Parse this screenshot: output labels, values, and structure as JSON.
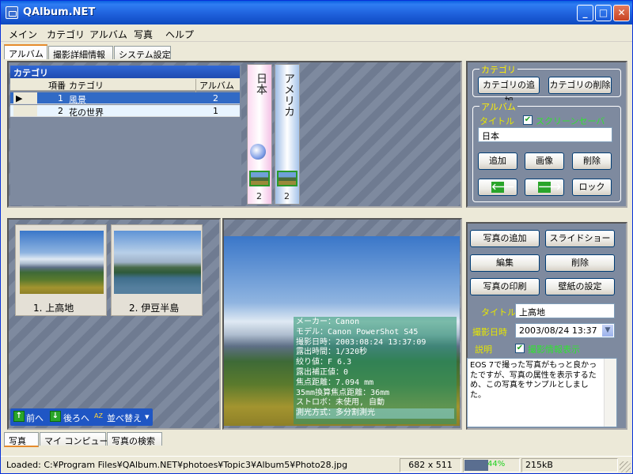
{
  "window": {
    "title": "QAlbum.NET"
  },
  "menu": [
    "メイン",
    "カテゴリ",
    "アルバム",
    "写真",
    "ヘルプ"
  ],
  "top_tabs": [
    "アルバム",
    "撮影詳細情報",
    "システム設定"
  ],
  "category_grid": {
    "caption": "カテゴリ",
    "headers": [
      "項番",
      "カテゴリ",
      "アルバム数"
    ],
    "rows": [
      {
        "no": "1",
        "name": "風景",
        "count": "2"
      },
      {
        "no": "2",
        "name": "花の世界",
        "count": "1"
      }
    ],
    "row_indicator": "▶"
  },
  "albums": [
    {
      "name": "日本",
      "count": "2"
    },
    {
      "name": "アメリカ",
      "count": "2"
    }
  ],
  "category_group": {
    "legend": "カテゴリ",
    "add_label": "カテゴリの追加",
    "delete_label": "カテゴリの削除"
  },
  "album_group": {
    "legend": "アルバム",
    "title_label": "タイトル",
    "screensaver_label": "スクリーンセーバ",
    "screensaver_checked": "✔",
    "title_value": "日本",
    "add_label": "追加",
    "image_label": "画像",
    "delete_label": "削除",
    "prev_icon": "🡐",
    "next_icon": "🡒",
    "lock_label": "ロック"
  },
  "photos": [
    {
      "caption": "1. 上高地"
    },
    {
      "caption": "2. 伊豆半島"
    }
  ],
  "photo_nav": {
    "prev_label": "前へ",
    "next_label": "後ろへ",
    "sort_label": "並べ替え",
    "sort_icon": "AZ",
    "dropdown_icon": "▾"
  },
  "exif": [
    "メーカー：Canon",
    "モデル：Canon PowerShot S45",
    "撮影日時：2003:08:24 13:37:09",
    "露出時間：1/320秒",
    "絞り値：F 6.3",
    "露出補正値：0",
    "焦点距離：7.094 mm",
    "35mm換算焦点距離：36mm",
    "ストロボ：未使用, 自動",
    "測光方式：多分割測光"
  ],
  "photo_actions": {
    "add_label": "写真の追加",
    "slideshow_label": "スライドショー",
    "edit_label": "編集",
    "delete_label": "削除",
    "print_label": "写真の印刷",
    "wallpaper_label": "壁紙の設定"
  },
  "photo_detail": {
    "title_label": "タイトル",
    "title_value": "上高地",
    "date_label": "撮影日時",
    "date_value": "2003/08/24 13:37",
    "desc_label": "説明",
    "exif_show_label": "撮影情報表示",
    "exif_checked": "✔",
    "description": "EOS 7で撮った写真がもっと良かったですが、写真の属性を表示するため、この写真をサンプルとしました。"
  },
  "bottom_tabs": [
    "写真",
    "マイ コンピュータ",
    "写真の検索"
  ],
  "status": {
    "loaded": "Loaded: C:¥Program Files¥QAlbum.NET¥photoes¥Topic3¥Album5¥Photo28.jpg",
    "dimensions": "682 x 511",
    "progress_text": "44%",
    "progress_value": 44,
    "size": "215kB"
  }
}
